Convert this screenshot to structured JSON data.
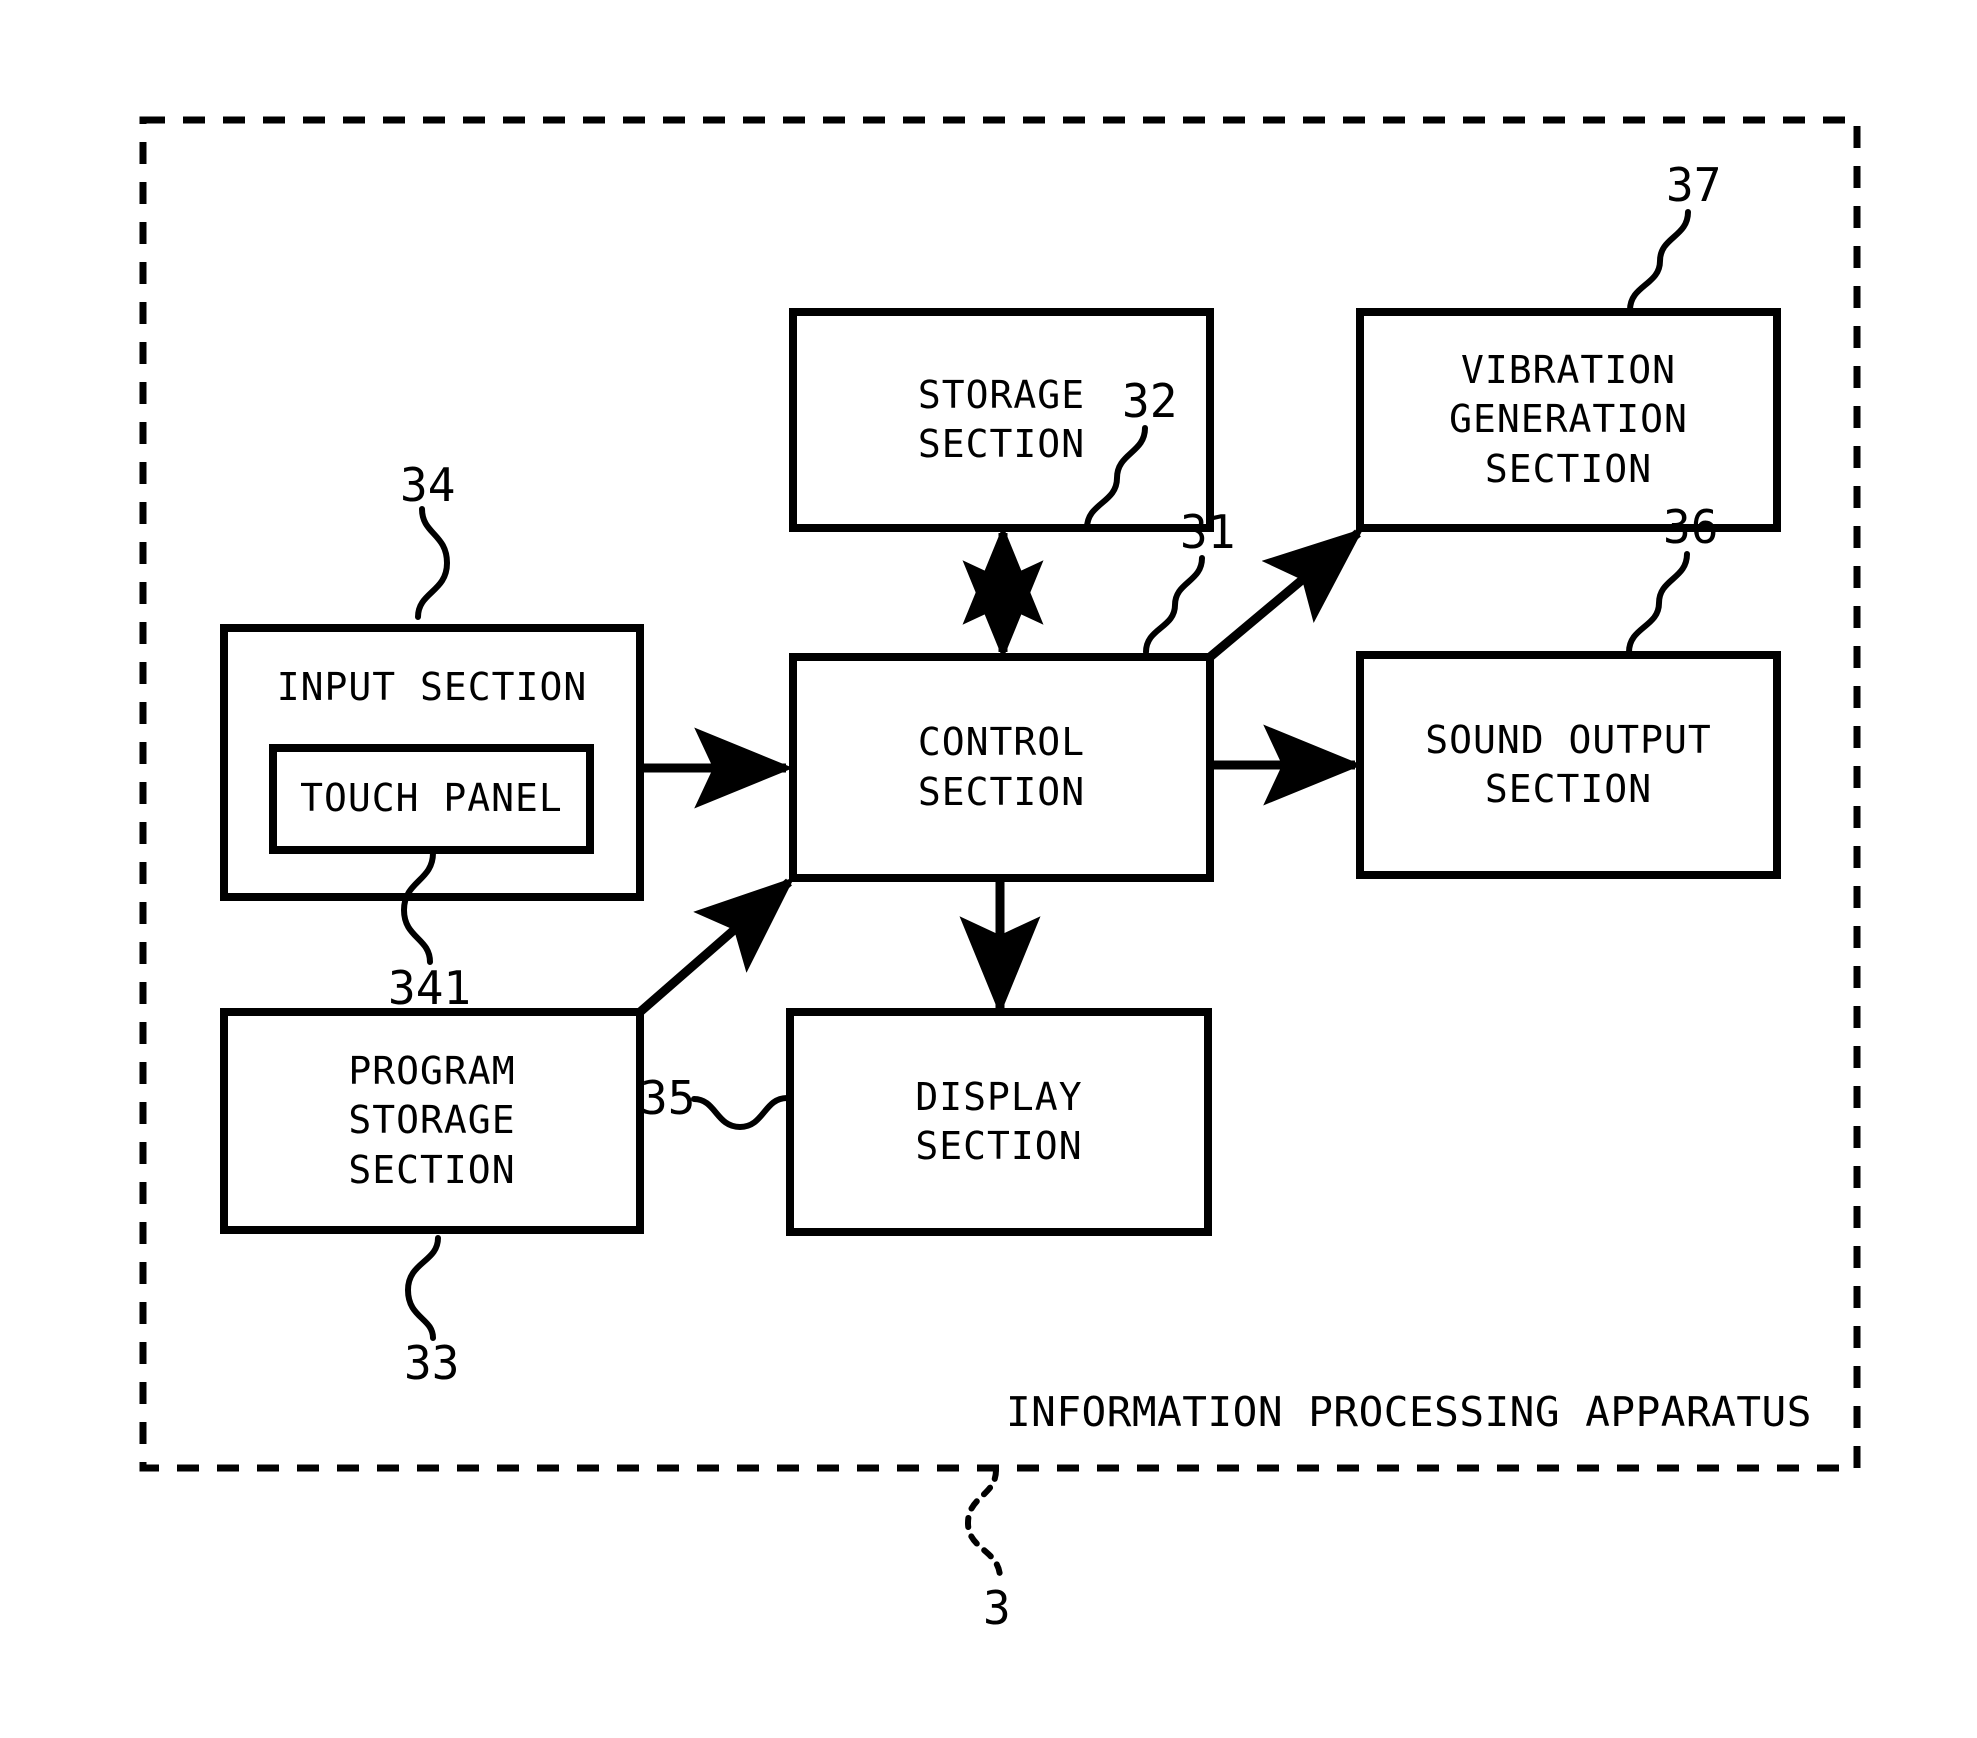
{
  "figure": {
    "caption": "INFORMATION PROCESSING APPARATUS",
    "apparatus_ref": "3",
    "stroke_color": "#000000",
    "background_color": "#ffffff"
  },
  "blocks": {
    "input_section": {
      "label": "INPUT SECTION",
      "ref": "34"
    },
    "touch_panel": {
      "label": "TOUCH PANEL",
      "ref": "341"
    },
    "program_storage_section": {
      "label_line1": "PROGRAM",
      "label_line2": "STORAGE",
      "label_line3": "SECTION",
      "ref": "33"
    },
    "storage_section": {
      "label_line1": "STORAGE",
      "label_line2": "SECTION",
      "ref": "32"
    },
    "control_section": {
      "label_line1": "CONTROL",
      "label_line2": "SECTION",
      "ref": "31"
    },
    "display_section": {
      "label_line1": "DISPLAY",
      "label_line2": "SECTION",
      "ref": "35"
    },
    "sound_output_section": {
      "label_line1": "SOUND OUTPUT",
      "label_line2": "SECTION",
      "ref": "36"
    },
    "vibration_generation_section": {
      "label_line1": "VIBRATION",
      "label_line2": "GENERATION",
      "label_line3": "SECTION",
      "ref": "37"
    }
  },
  "connections": [
    {
      "from": "input_section",
      "to": "control_section",
      "style": "single-arrow-right"
    },
    {
      "from": "program_storage_section",
      "to": "control_section",
      "style": "single-arrow-diagonal-up-right"
    },
    {
      "from": "storage_section",
      "to": "control_section",
      "style": "double-arrow-vertical"
    },
    {
      "from": "control_section",
      "to": "display_section",
      "style": "single-arrow-down"
    },
    {
      "from": "control_section",
      "to": "sound_output_section",
      "style": "single-arrow-right"
    },
    {
      "from": "control_section",
      "to": "vibration_generation_section",
      "style": "single-arrow-diagonal-up-right"
    }
  ]
}
